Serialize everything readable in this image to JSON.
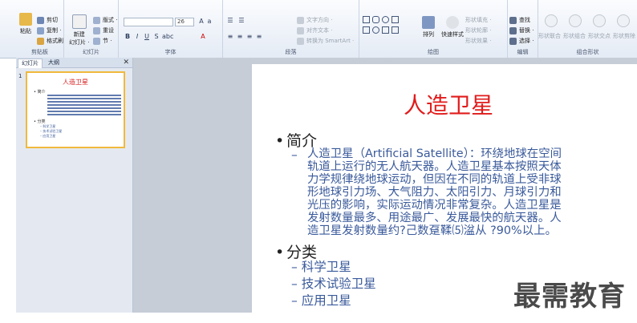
{
  "ribbon": {
    "clipboard": {
      "paste": "粘贴",
      "cut": "剪切",
      "copy": "复制 ·",
      "format_painter": "格式刷",
      "label": "剪贴板"
    },
    "slides": {
      "new_slide": "新建",
      "new_slide2": "幻灯片 ·",
      "layout": "版式 ·",
      "reset": "重设",
      "section": "节 ·",
      "label": "幻灯片"
    },
    "font": {
      "font_name": "",
      "font_size": "26",
      "label": "字体"
    },
    "paragraph": {
      "text_direction": "文字方向 ·",
      "align_text": "对齐文本 ·",
      "convert_smartart": "转换为 SmartArt ·",
      "label": "段落"
    },
    "drawing": {
      "arrange": "排列",
      "quick_styles": "快速样式",
      "shape_fill": "形状填充 ·",
      "shape_outline": "形状轮廓 ·",
      "shape_effects": "形状效果 ·",
      "label": "绘图"
    },
    "editing": {
      "find": "查找",
      "replace": "替换 ·",
      "select": "选择 ·",
      "label": "编辑"
    },
    "combine": {
      "union": "形状联合",
      "combine": "形状组合",
      "intersect": "形状交点",
      "subtract": "形状剪除",
      "label": "组合形状"
    }
  },
  "sidebar": {
    "tabs": [
      "幻灯片",
      "大纲"
    ],
    "close": "✕",
    "slide_number": "1",
    "thumb": {
      "title": "人造卫星",
      "item1": "• 简介",
      "item2": "• 分类",
      "sub1": "– 科学卫星",
      "sub2": "– 技术试验卫星",
      "sub3": "– 应用卫星"
    }
  },
  "slide": {
    "title": "人造卫星",
    "bullet1": "简介",
    "intro_lines": [
      "人造卫星（Artificial Satellite）：环绕地球在空间",
      "轨道上运行的无人航天器。人造卫星基本按照天体",
      "力学规律绕地球运动，但因在不同的轨道上受非球",
      "形地球引力场、大气阻力、太阳引力、月球引力和",
      "光压的影响，实际运动情况非常复杂。人造卫星是",
      "发射数量最多、用途最广、发展最快的航天器。人",
      "造卫星发射数量约?己数趸鞣⑸湓从    ?90%以上。"
    ],
    "bullet2": "分类",
    "categories": [
      "科学卫星",
      "技术试验卫星",
      "应用卫星"
    ]
  },
  "watermark": "最需教育"
}
